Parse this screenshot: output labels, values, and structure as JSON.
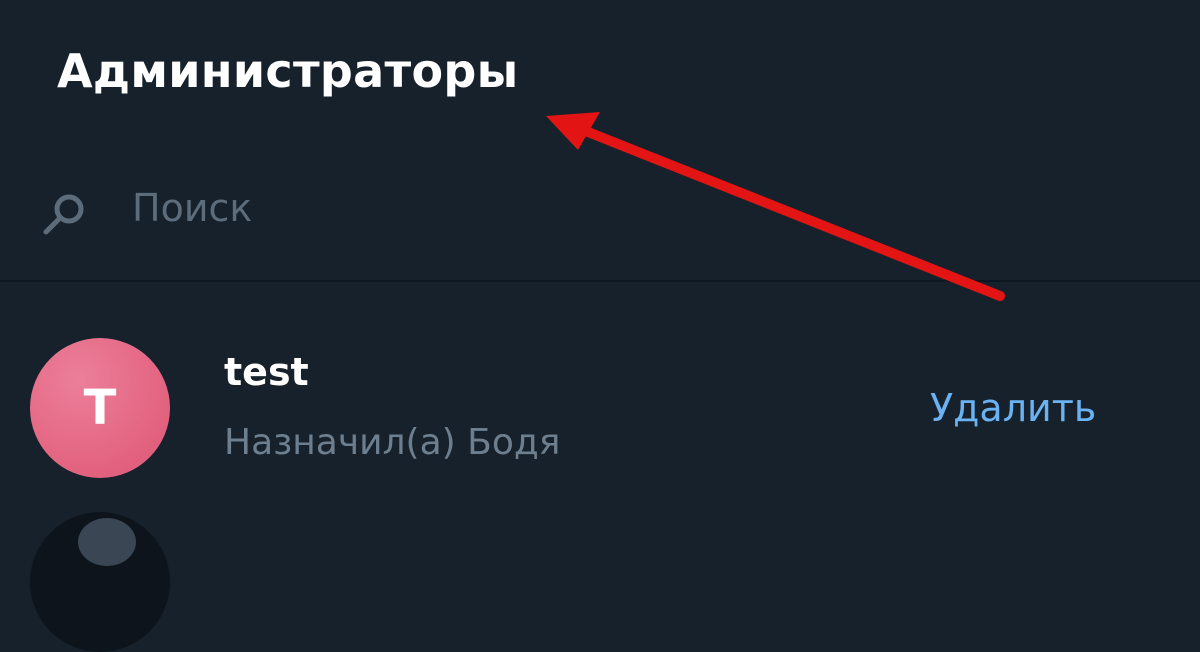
{
  "header": {
    "title": "Администраторы"
  },
  "search": {
    "placeholder": "Поиск",
    "icon": "search-icon"
  },
  "admins": [
    {
      "avatar_letter": "T",
      "avatar_color": "#e2627f",
      "name": "test",
      "status": "Назначил(а) Бодя",
      "action_label": "Удалить"
    }
  ],
  "colors": {
    "background": "#17212b",
    "accent": "#6ab2f2",
    "secondary_text": "#6d7f8f",
    "annotation_arrow": "#e31414"
  }
}
